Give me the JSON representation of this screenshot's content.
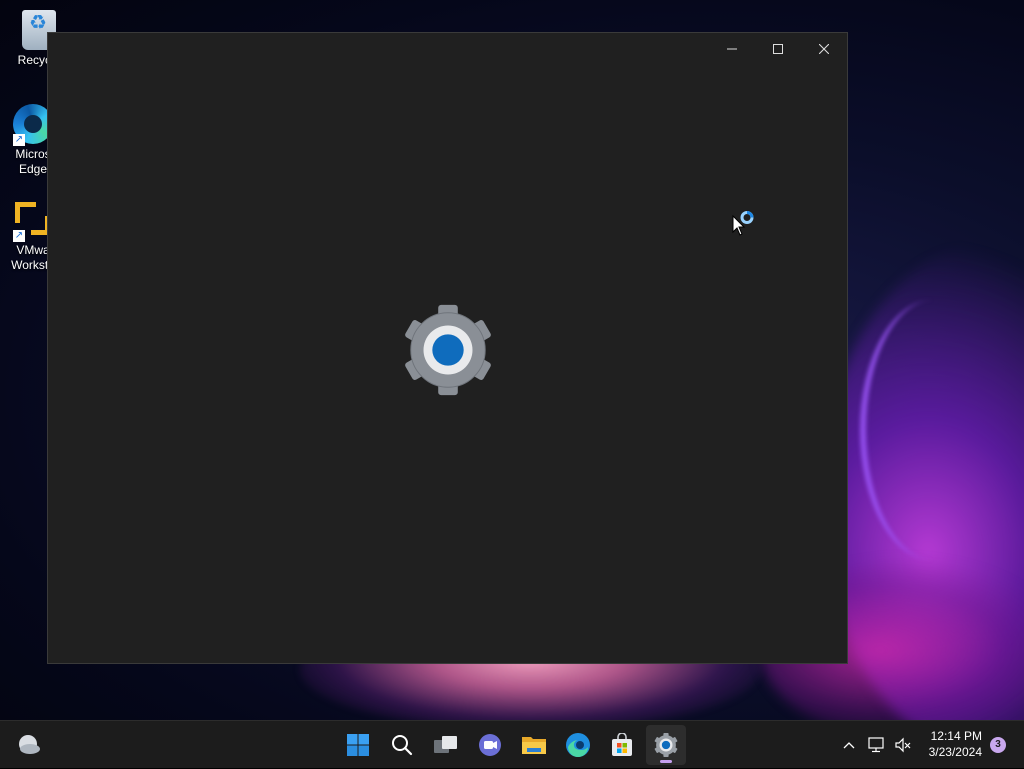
{
  "desktop": {
    "icons": [
      {
        "label": "Recycle",
        "icon": "recycle-bin-icon"
      },
      {
        "label": "Micros Edge",
        "line1": "Micros",
        "line2": "Edge",
        "icon": "edge-icon"
      },
      {
        "label": "VMwa Workst",
        "line1": "VMwa",
        "line2": "Worksta",
        "icon": "vmware-icon"
      }
    ]
  },
  "window": {
    "app": "Settings",
    "splash_icon": "settings-gear-icon",
    "state": "loading",
    "caption_buttons": [
      "minimize",
      "maximize",
      "close"
    ]
  },
  "taskbar": {
    "pinned": [
      {
        "name": "start",
        "icon": "windows-start-icon"
      },
      {
        "name": "search",
        "icon": "search-icon"
      },
      {
        "name": "task-view",
        "icon": "task-view-icon"
      },
      {
        "name": "chat",
        "icon": "teams-chat-icon"
      },
      {
        "name": "file-explorer",
        "icon": "folder-icon"
      },
      {
        "name": "edge",
        "icon": "edge-icon"
      },
      {
        "name": "store",
        "icon": "store-icon"
      },
      {
        "name": "settings",
        "icon": "settings-gear-icon",
        "active": true
      }
    ],
    "tray": {
      "icons": [
        "chevron-up-icon",
        "network-icon",
        "volume-muted-icon"
      ],
      "time": "12:14 PM",
      "date": "3/23/2024",
      "notification_count": "3"
    }
  },
  "colors": {
    "window_bg": "#202020",
    "taskbar_bg": "#1c1c1c",
    "accent": "#0f6cbd",
    "indicator": "#c6a0f0"
  }
}
